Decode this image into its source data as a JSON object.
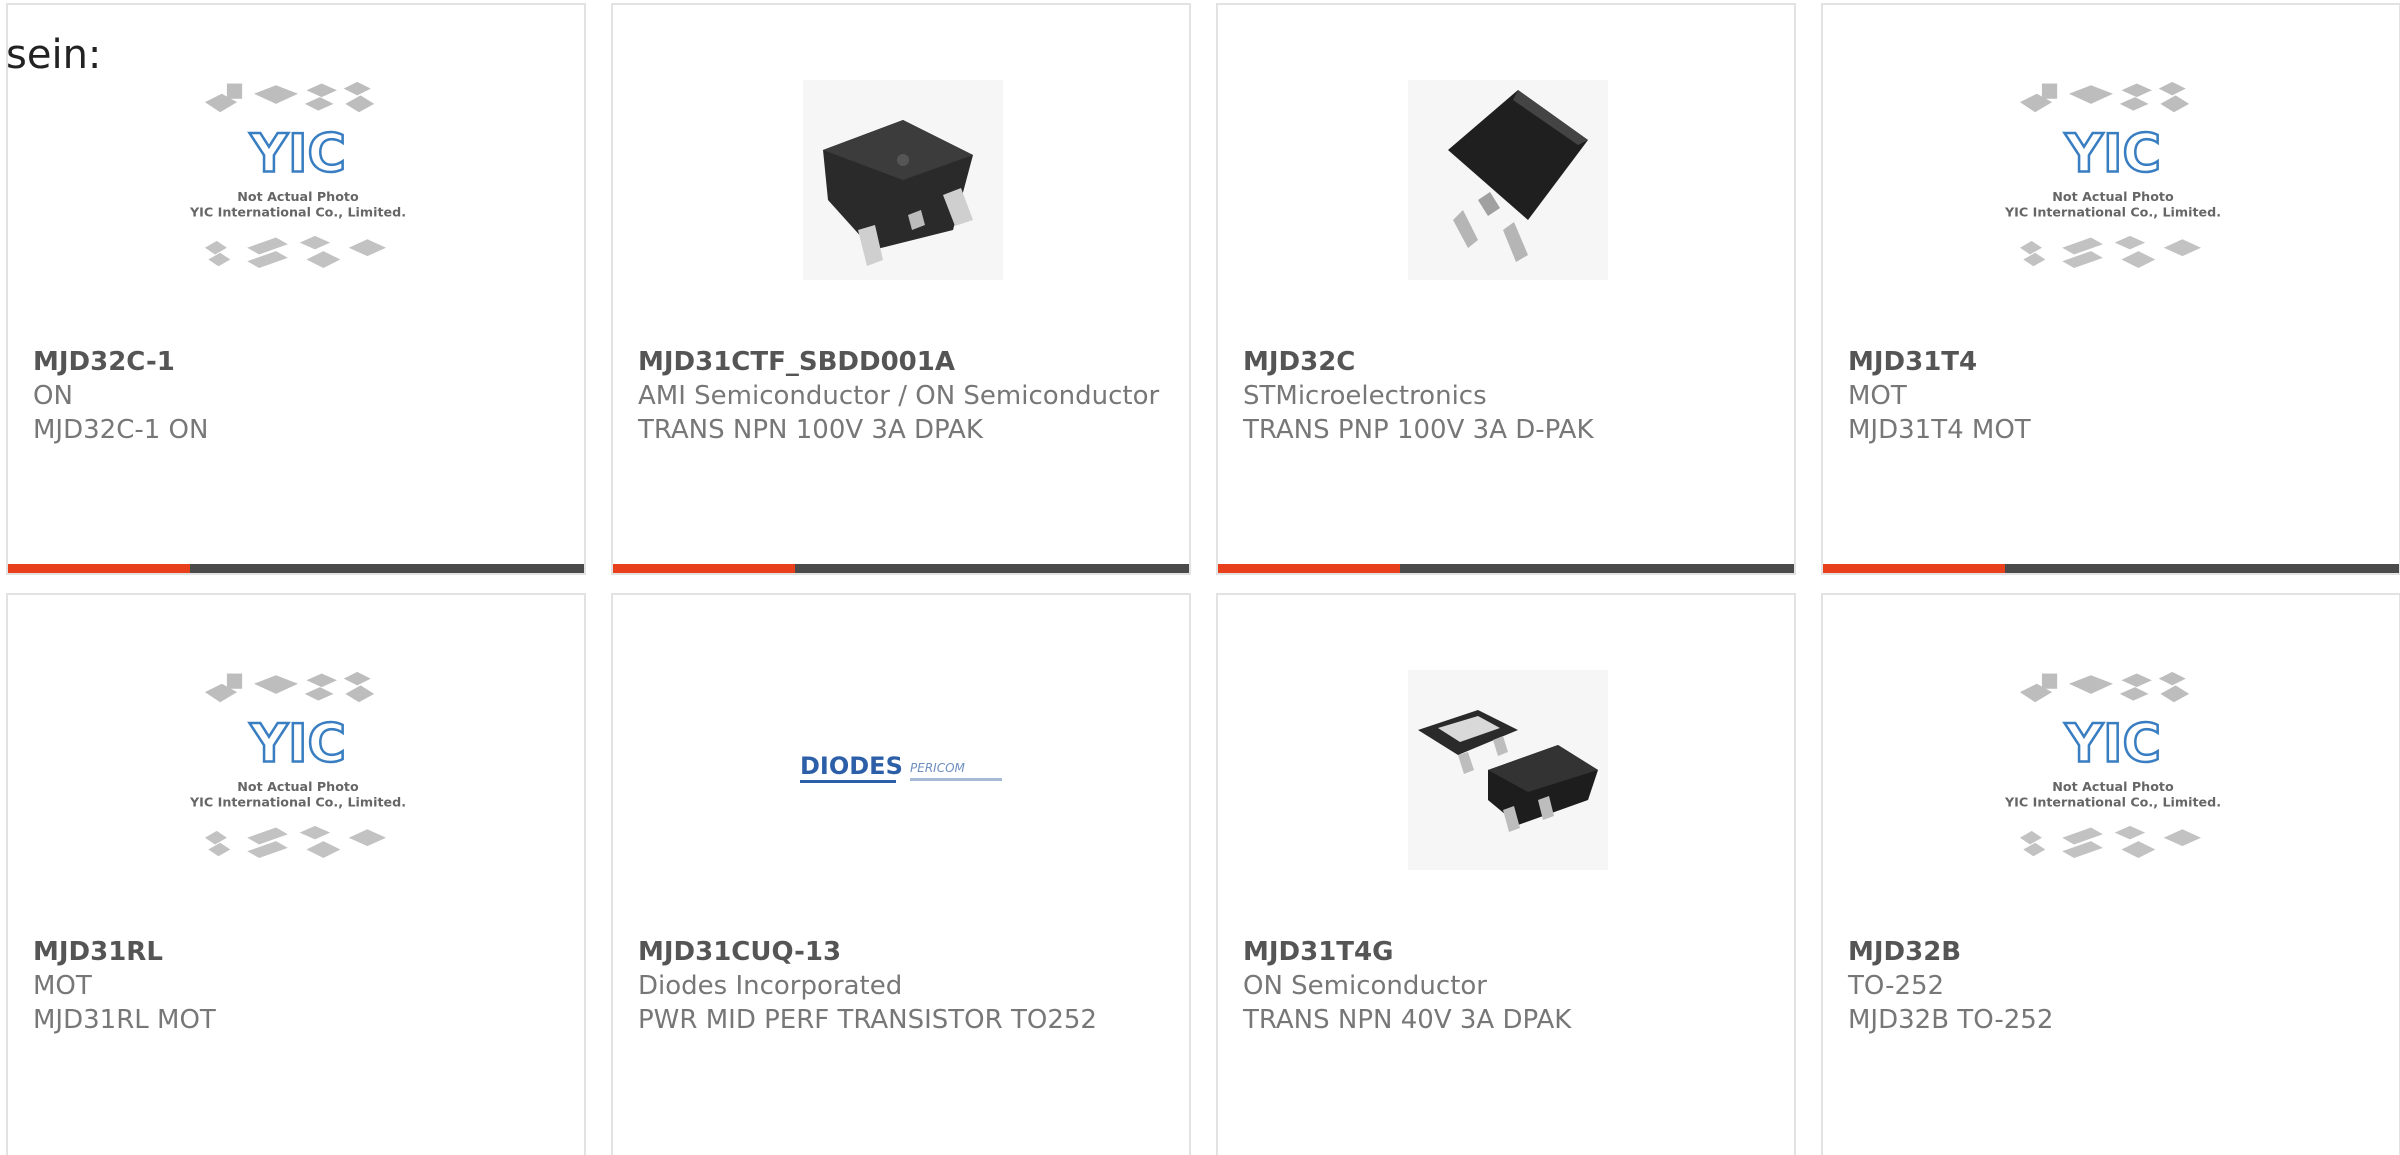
{
  "intro_text": "sein:",
  "colors": {
    "accent": "#e8401c",
    "bar": "#4a4a4a",
    "border": "#e2e2e2",
    "text": "#777777",
    "part_number": "#555555"
  },
  "placeholder": {
    "line1": "Not Actual Photo",
    "line2": "YIC International Co., Limited.",
    "logo": "YIC"
  },
  "products": [
    {
      "part": "MJD32C-1",
      "manufacturer": "ON",
      "description": "MJD32C-1 ON",
      "image": "placeholder"
    },
    {
      "part": "MJD31CTF_SBDD001A",
      "manufacturer": "AMI Semiconductor / ON Semiconductor",
      "description": "TRANS NPN 100V 3A DPAK",
      "image": "dpak-chip-icon"
    },
    {
      "part": "MJD32C",
      "manufacturer": "STMicroelectronics",
      "description": "TRANS PNP 100V 3A D-PAK",
      "image": "dpak-tilted-icon"
    },
    {
      "part": "MJD31T4",
      "manufacturer": "MOT",
      "description": "MJD31T4 MOT",
      "image": "placeholder"
    },
    {
      "part": "MJD31RL",
      "manufacturer": "MOT",
      "description": "MJD31RL MOT",
      "image": "placeholder"
    },
    {
      "part": "MJD31CUQ-13",
      "manufacturer": "Diodes Incorporated",
      "description": "PWR MID PERF TRANSISTOR TO252",
      "image": "diodes-logo",
      "logo_text": "DIODES",
      "logo_text2": "PERICOM"
    },
    {
      "part": "MJD31T4G",
      "manufacturer": "ON Semiconductor",
      "description": "TRANS NPN 40V 3A DPAK",
      "image": "dpak-pair-icon"
    },
    {
      "part": "MJD32B",
      "manufacturer": "TO-252",
      "description": "MJD32B TO-252",
      "image": "placeholder"
    }
  ]
}
